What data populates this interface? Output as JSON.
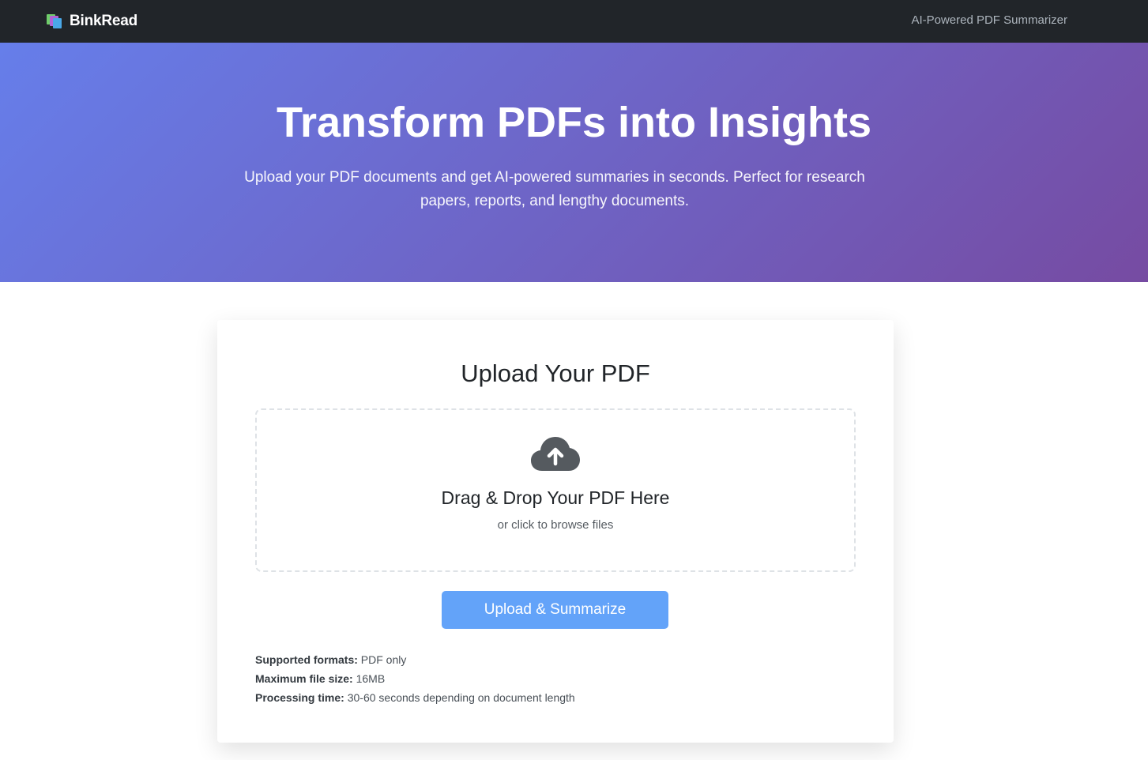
{
  "navbar": {
    "brand": "BinkRead",
    "brand_icon": "books-icon",
    "tagline": "AI-Powered PDF Summarizer",
    "background": "#212529"
  },
  "hero": {
    "title": "Transform PDFs into Insights",
    "subtitle": "Upload your PDF documents and get AI-powered summaries in seconds. Perfect for research papers, reports, and lengthy documents.",
    "gradient_start": "#667eea",
    "gradient_end": "#764ba2"
  },
  "upload": {
    "title": "Upload Your PDF",
    "dropzone_icon": "cloud-upload-icon",
    "dropzone_title": "Drag & Drop Your PDF Here",
    "dropzone_subtitle": "or click to browse files",
    "button_label": "Upload & Summarize",
    "button_color": "#63a3f9"
  },
  "info": [
    {
      "label": "Supported formats:",
      "value": "PDF only"
    },
    {
      "label": "Maximum file size:",
      "value": "16MB"
    },
    {
      "label": "Processing time:",
      "value": "30-60 seconds depending on document length"
    }
  ]
}
